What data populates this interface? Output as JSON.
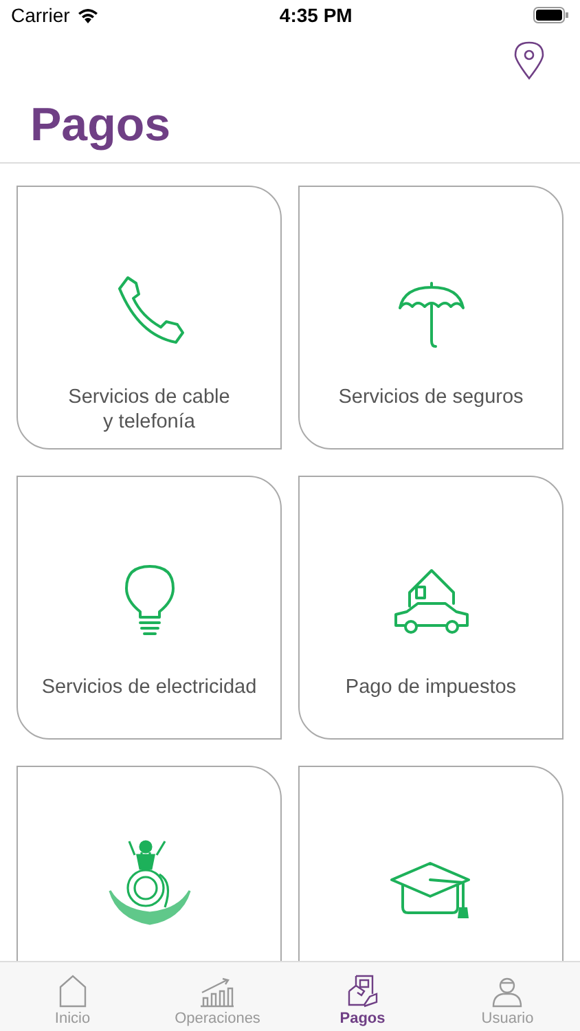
{
  "status_bar": {
    "carrier": "Carrier",
    "time": "4:35 PM"
  },
  "title": "Pagos",
  "services": [
    {
      "kind": "phone",
      "label": "Servicios de cable\ny telefonía"
    },
    {
      "kind": "umbrella",
      "label": "Servicios de seguros"
    },
    {
      "kind": "bulb",
      "label": "Servicios de electricidad"
    },
    {
      "kind": "house-car",
      "label": "Pago de impuestos"
    },
    {
      "kind": "emblem"
    },
    {
      "kind": "cap"
    }
  ],
  "tabs": [
    {
      "kind": "home",
      "label": "Inicio",
      "selected": false
    },
    {
      "kind": "chart",
      "label": "Operaciones",
      "selected": false
    },
    {
      "kind": "pay",
      "label": "Pagos",
      "selected": true
    },
    {
      "kind": "user",
      "label": "Usuario",
      "selected": false
    }
  ]
}
